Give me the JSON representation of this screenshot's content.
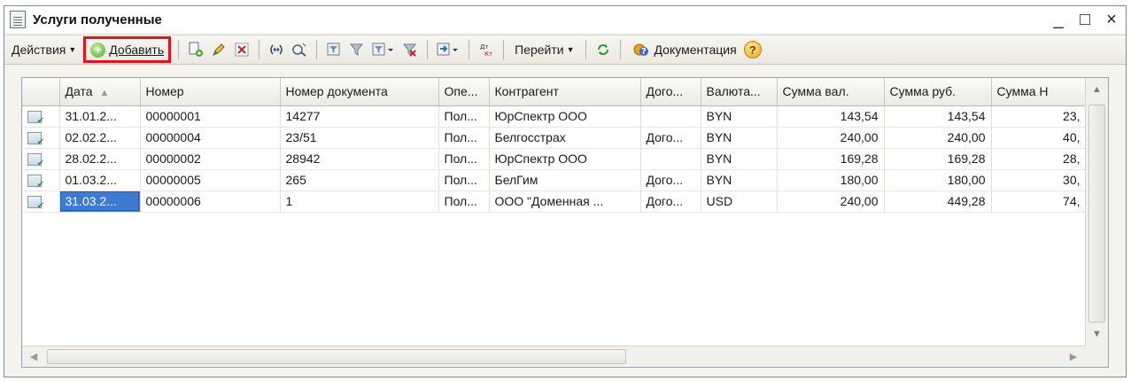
{
  "window": {
    "title": "Услуги полученные",
    "controls": {
      "minimize": "_",
      "maximize": "□",
      "close": "×"
    }
  },
  "toolbar": {
    "actions_label": "Действия",
    "add_label": "Добавить",
    "goto_label": "Перейти",
    "docs_label": "Документация",
    "help_label": "?"
  },
  "table": {
    "columns": [
      "Дата",
      "Номер",
      "Номер документа",
      "Опе...",
      "Контрагент",
      "Дого...",
      "Валюта...",
      "Сумма вал.",
      "Сумма руб.",
      "Сумма Н"
    ],
    "rows": [
      {
        "date": "31.01.2...",
        "number": "00000001",
        "doc_number": "14277",
        "operation": "Пол...",
        "counterparty": "ЮрСпектр ООО",
        "contract": "",
        "currency": "BYN",
        "sum_cur": "143,54",
        "sum_rub": "143,54",
        "sum_vat": "23,"
      },
      {
        "date": "02.02.2...",
        "number": "00000004",
        "doc_number": "23/51",
        "operation": "Пол...",
        "counterparty": "Белгосстрах",
        "contract": "Дого...",
        "currency": "BYN",
        "sum_cur": "240,00",
        "sum_rub": "240,00",
        "sum_vat": "40,"
      },
      {
        "date": "28.02.2...",
        "number": "00000002",
        "doc_number": "28942",
        "operation": "Пол...",
        "counterparty": "ЮрСпектр ООО",
        "contract": "",
        "currency": "BYN",
        "sum_cur": "169,28",
        "sum_rub": "169,28",
        "sum_vat": "28,"
      },
      {
        "date": "01.03.2...",
        "number": "00000005",
        "doc_number": "265",
        "operation": "Пол...",
        "counterparty": "БелГим",
        "contract": "Дого...",
        "currency": "BYN",
        "sum_cur": "180,00",
        "sum_rub": "180,00",
        "sum_vat": "30,"
      },
      {
        "date": "31.03.2...",
        "number": "00000006",
        "doc_number": "1",
        "operation": "Пол...",
        "counterparty": "ООО \"Доменная ...",
        "contract": "Дого...",
        "currency": "USD",
        "sum_cur": "240,00",
        "sum_rub": "449,28",
        "sum_vat": "74,"
      }
    ],
    "selected_row": 4
  },
  "colors": {
    "highlight_border": "#e4131a",
    "selection": "#3d7bd1"
  }
}
